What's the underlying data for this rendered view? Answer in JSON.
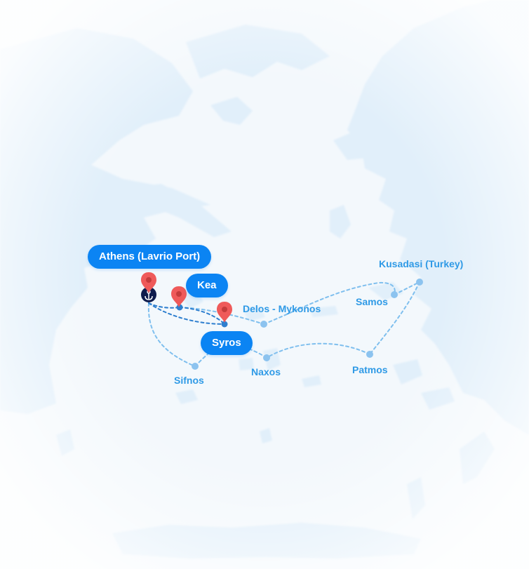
{
  "colors": {
    "sea": "#f3f8fc",
    "land": "#e1effa",
    "route": "#7fbfee",
    "route_dark": "#2e7fcf",
    "stop": "#8cc3ef",
    "pill": "#0b84f3",
    "pin": "#ef5a5a",
    "port_icon": "#0f1c4d"
  },
  "icons": {
    "pin": "map-pin-icon",
    "port": "anchor-icon"
  },
  "highlighted_stops": {
    "athens": "Athens (Lavrio Port)",
    "kea": "Kea",
    "syros": "Syros"
  },
  "stops": {
    "delos_mykonos": "Delos - Mykonos",
    "kusadasi": "Kusadasi (Turkey)",
    "samos": "Samos",
    "patmos": "Patmos",
    "naxos": "Naxos",
    "sifnos": "Sifnos"
  }
}
